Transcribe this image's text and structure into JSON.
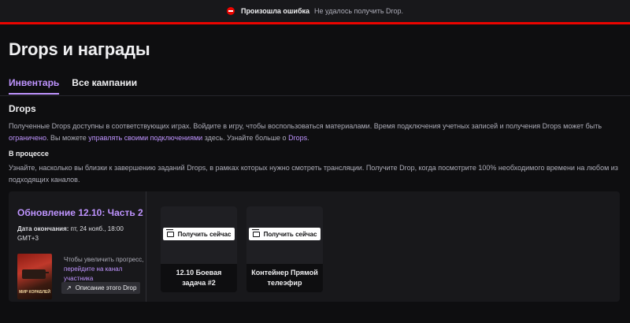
{
  "banner": {
    "title": "Произошла ошибка",
    "message": "Не удалось получить Drop."
  },
  "page_title": "Drops и награды",
  "tabs": [
    {
      "label": "Инвентарь",
      "active": true
    },
    {
      "label": "Все кампании",
      "active": false
    }
  ],
  "drops_section": {
    "title": "Drops",
    "desc_part1": "Полученные Drops доступны в соответствующих играх. Войдите в игру, чтобы воспользоваться материалами. Время подключения учетных записей и получения Drops может быть ",
    "link_limited": "ограничено",
    "desc_part2": ". Вы можете ",
    "link_manage": "управлять своими подключениями",
    "desc_part3": " здесь. Узнайте больше о ",
    "link_drops": "Drops",
    "desc_part4": "."
  },
  "in_progress": {
    "title": "В процессе",
    "desc": "Узнайте, насколько вы близки к завершению заданий Drops, в рамках которых нужно смотреть трансляции. Получите Drop, когда посмотрите 100% необходимого времени на любом из подходящих каналов."
  },
  "campaign": {
    "name": "Обновление 12.10: Часть 2",
    "end_label": "Дата окончания:",
    "end_value": " пт, 24 нояб., 18:00 GMT+3",
    "game_cover_text": "МИР КОРАБЛЕЙ",
    "hint_prefix": "Чтобы увеличить прогресс, ",
    "hint_link": "перейдите на канал участника",
    "desc_button": "Описание этого Drop",
    "drops": [
      {
        "claim_label": "Получить сейчас",
        "name": "12.10 Боевая задача #2"
      },
      {
        "claim_label": "Получить сейчас",
        "name": "Контейнер Прямой телеэфир"
      }
    ]
  },
  "colors": {
    "accent": "#bf94ff",
    "error": "#eb0400",
    "background": "#0e0e10"
  }
}
